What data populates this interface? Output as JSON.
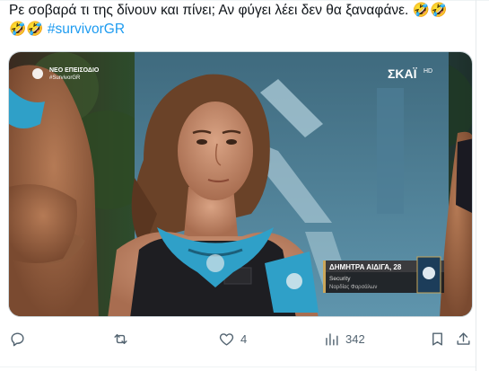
{
  "tweet": {
    "text_line1": "Ρε σοβαρά τι της δίνουν και πίνει; Αν φύγει λέει δεν θα ξαναφάνε. 🤣🤣",
    "text_line2_emoji": "🤣🤣 ",
    "hashtag": "#survivorGR"
  },
  "media": {
    "channel_badge_line1": "ΝΕΟ ΕΠΕΙΣΟΔΙΟ",
    "channel_badge_line2": "#SurvivorGR",
    "broadcaster_logo": "ΣΚΑΪ",
    "broadcaster_suffix": "HD",
    "lower_third_name": "ΔΗΜΗΤΡΑ ΑΙΔΙΓΑ, 28",
    "lower_third_role": "Security",
    "lower_third_location": "Ναρδίας Φαρσάλων",
    "colors": {
      "sky": "#1f3a3a",
      "jungle": "#2d4a2a",
      "sign": "#5b8fa8",
      "bandana": "#2fa0c8",
      "lower_third": "#2b2b2b",
      "accent_gold": "#c9a65a"
    }
  },
  "actions": {
    "reply": {
      "icon": "reply-icon",
      "count": ""
    },
    "retweet": {
      "icon": "retweet-icon",
      "count": ""
    },
    "like": {
      "icon": "heart-icon",
      "count": "4"
    },
    "views": {
      "icon": "views-icon",
      "count": "342"
    },
    "bookmark": {
      "icon": "bookmark-icon"
    },
    "share": {
      "icon": "share-icon"
    }
  }
}
